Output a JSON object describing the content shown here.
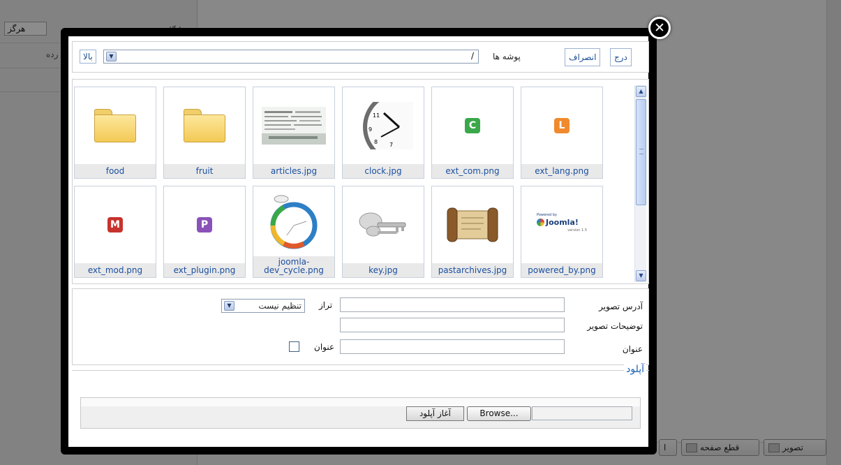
{
  "background": {
    "left_rows": [
      {
        "label": "بایگانی",
        "value": "هرگز"
      },
      {
        "label": "رده"
      }
    ],
    "editor_buttons": [
      {
        "label": "تصویر",
        "icon": "image-icon"
      },
      {
        "label": "قطع صفحه",
        "icon": "pagebreak-icon"
      },
      {
        "label": "ا"
      }
    ]
  },
  "toolbar": {
    "insert_label": "درج",
    "cancel_label": "انصراف",
    "folders_label": "پوشه ها",
    "current_dir": "/",
    "up_label": "بالا"
  },
  "browser": {
    "items": [
      {
        "name": "food",
        "type": "folder"
      },
      {
        "name": "fruit",
        "type": "folder"
      },
      {
        "name": "articles.jpg",
        "type": "image",
        "icon": "articles-thumbnail"
      },
      {
        "name": "clock.jpg",
        "type": "image",
        "icon": "clock-thumbnail"
      },
      {
        "name": "ext_com.png",
        "type": "image",
        "icon": "letter-c-icon",
        "letter": "C",
        "color": "#3aa84a"
      },
      {
        "name": "ext_lang.png",
        "type": "image",
        "icon": "letter-l-icon",
        "letter": "L",
        "color": "#f08a2c"
      },
      {
        "name": "ext_mod.png",
        "type": "image",
        "icon": "letter-m-icon",
        "letter": "M",
        "color": "#c8322c"
      },
      {
        "name": "ext_plugin.png",
        "type": "image",
        "icon": "letter-p-icon",
        "letter": "P",
        "color": "#8a52b8"
      },
      {
        "name": "joomla-\ndev_cycle.png",
        "type": "image",
        "icon": "dev-cycle-thumbnail"
      },
      {
        "name": "key.jpg",
        "type": "image",
        "icon": "key-thumbnail"
      },
      {
        "name": "pastarchives.jpg",
        "type": "image",
        "icon": "scroll-thumbnail"
      },
      {
        "name": "powered_by.png",
        "type": "image",
        "icon": "joomla-logo-thumbnail",
        "logo_text": "Joomla!",
        "logo_small": "Powered by",
        "logo_version": "version 1.5"
      }
    ]
  },
  "properties": {
    "image_url_label": "آدرس تصویر",
    "image_desc_label": "توضیحات تصویر",
    "title_label": "عنوان",
    "align_label": "تراز",
    "align_value": "تنظیم نیست",
    "caption_label": "عنوان",
    "image_url_value": "",
    "image_desc_value": "",
    "title_value": ""
  },
  "upload": {
    "legend": "آپلود",
    "browse_label": "Browse...",
    "start_label": "آغاز آپلود"
  },
  "close_label": "✕"
}
